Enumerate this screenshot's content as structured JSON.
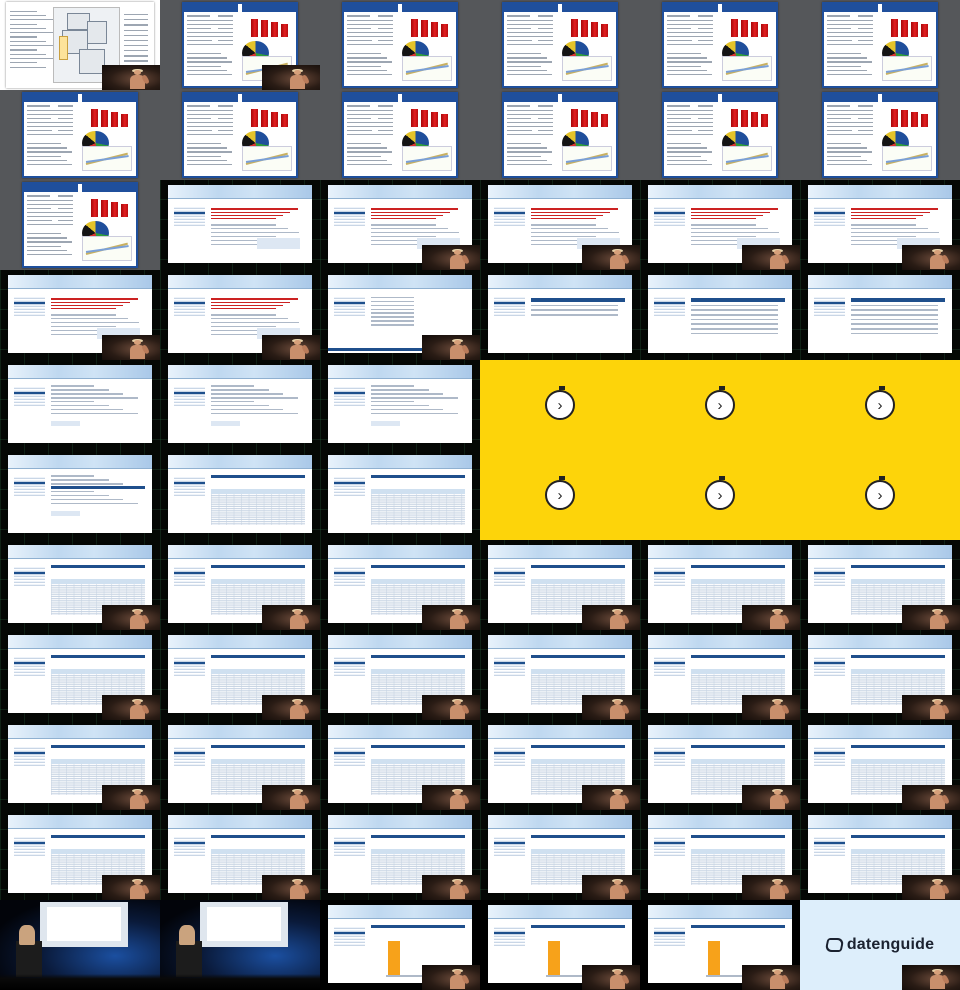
{
  "sheet": {
    "columns": 6,
    "rows": 11,
    "theme": "video thumbnail contact sheet"
  },
  "panels": [
    {
      "type": "map",
      "bg": "white"
    },
    {
      "type": "stats",
      "bg": "gray",
      "titles": [
        "Politik und Verwaltung",
        "Wirtschaft"
      ]
    },
    {
      "type": "stats",
      "bg": "gray",
      "titles": [
        "Politik und Verwaltung",
        "Wirtschaft"
      ]
    },
    {
      "type": "stats",
      "bg": "gray",
      "titles": [
        "Politik und Verwaltung",
        "Wirtschaft"
      ]
    },
    {
      "type": "stats",
      "bg": "gray",
      "titles": [
        "Politik und Verwaltung",
        "Wirtschaft"
      ]
    },
    {
      "type": "stats",
      "bg": "gray",
      "titles": [
        "Politik und Verwaltung",
        "Wirtschaft"
      ]
    },
    {
      "type": "stats",
      "bg": "gray",
      "titles": [
        "Politik und Verwaltung",
        "Wirtschaft"
      ]
    },
    {
      "type": "stats",
      "bg": "gray",
      "titles": [
        "Politik und Verwaltung",
        "Wirtschaft"
      ]
    },
    {
      "type": "stats",
      "bg": "gray",
      "titles": [
        "Politik und Verwaltung",
        "Wirtschaft"
      ]
    },
    {
      "type": "stats",
      "bg": "gray",
      "titles": [
        "Politik und Verwaltung",
        "Wirtschaft"
      ]
    },
    {
      "type": "stats",
      "bg": "gray",
      "titles": [
        "Politik und Verwaltung",
        "Wirtschaft"
      ]
    },
    {
      "type": "stats",
      "bg": "gray",
      "titles": [
        "Politik und Verwaltung",
        "Wirtschaft"
      ]
    },
    {
      "type": "stats",
      "bg": "gray",
      "titles": [
        "Politik und Verwaltung",
        "Wirtschaft"
      ]
    },
    {
      "type": "web",
      "bg": "circuit",
      "variant": "notice"
    },
    {
      "type": "web",
      "bg": "circuit",
      "variant": "notice"
    },
    {
      "type": "web",
      "bg": "circuit",
      "variant": "notice"
    },
    {
      "type": "web",
      "bg": "circuit",
      "variant": "notice"
    },
    {
      "type": "web",
      "bg": "circuit",
      "variant": "notice"
    },
    {
      "type": "web",
      "bg": "circuit",
      "variant": "notice"
    },
    {
      "type": "web",
      "bg": "circuit",
      "variant": "notice"
    },
    {
      "type": "web",
      "bg": "circuit",
      "variant": "list"
    },
    {
      "type": "web",
      "bg": "circuit",
      "variant": "search"
    },
    {
      "type": "web",
      "bg": "circuit",
      "variant": "results"
    },
    {
      "type": "web",
      "bg": "circuit",
      "variant": "results"
    },
    {
      "type": "web",
      "bg": "circuit",
      "variant": "form"
    },
    {
      "type": "web",
      "bg": "circuit",
      "variant": "form"
    },
    {
      "type": "web",
      "bg": "circuit",
      "variant": "form"
    },
    {
      "type": "stopwatch",
      "bg": "yellow"
    },
    {
      "type": "stopwatch",
      "bg": "yellow"
    },
    {
      "type": "stopwatch",
      "bg": "yellow"
    },
    {
      "type": "web",
      "bg": "circuit",
      "variant": "form2"
    },
    {
      "type": "web",
      "bg": "circuit",
      "variant": "table"
    },
    {
      "type": "web",
      "bg": "circuit",
      "variant": "table"
    },
    {
      "type": "web",
      "bg": "circuit",
      "variant": "table"
    },
    {
      "type": "web",
      "bg": "circuit",
      "variant": "table"
    },
    {
      "type": "web",
      "bg": "circuit",
      "variant": "table"
    },
    {
      "type": "web",
      "bg": "circuit",
      "variant": "table"
    },
    {
      "type": "web",
      "bg": "circuit",
      "variant": "table"
    },
    {
      "type": "web",
      "bg": "circuit",
      "variant": "table"
    },
    {
      "type": "web",
      "bg": "circuit",
      "variant": "table"
    },
    {
      "type": "web",
      "bg": "circuit",
      "variant": "table"
    },
    {
      "type": "web",
      "bg": "circuit",
      "variant": "table"
    },
    {
      "type": "web",
      "bg": "circuit",
      "variant": "table"
    },
    {
      "type": "web",
      "bg": "circuit",
      "variant": "table"
    },
    {
      "type": "web",
      "bg": "circuit",
      "variant": "table"
    },
    {
      "type": "web",
      "bg": "circuit",
      "variant": "table"
    },
    {
      "type": "web",
      "bg": "circuit",
      "variant": "table"
    },
    {
      "type": "web",
      "bg": "circuit",
      "variant": "table"
    },
    {
      "type": "web",
      "bg": "circuit",
      "variant": "table"
    },
    {
      "type": "web",
      "bg": "circuit",
      "variant": "table"
    },
    {
      "type": "web",
      "bg": "circuit",
      "variant": "table"
    },
    {
      "type": "web",
      "bg": "circuit",
      "variant": "table"
    },
    {
      "type": "web",
      "bg": "circuit",
      "variant": "table"
    },
    {
      "type": "web",
      "bg": "circuit",
      "variant": "table"
    },
    {
      "type": "web",
      "bg": "circuit",
      "variant": "table"
    },
    {
      "type": "web",
      "bg": "circuit",
      "variant": "table"
    },
    {
      "type": "web",
      "bg": "circuit",
      "variant": "table"
    },
    {
      "type": "web",
      "bg": "circuit",
      "variant": "table"
    },
    {
      "type": "web",
      "bg": "circuit",
      "variant": "table"
    },
    {
      "type": "web",
      "bg": "circuit",
      "variant": "table"
    },
    {
      "type": "web",
      "bg": "circuit",
      "variant": "table"
    },
    {
      "type": "stage",
      "bg": "stage"
    },
    {
      "type": "stage",
      "bg": "stage"
    },
    {
      "type": "web",
      "bg": "black",
      "variant": "barchart"
    },
    {
      "type": "web",
      "bg": "black",
      "variant": "barchart"
    },
    {
      "type": "web",
      "bg": "black",
      "variant": "barchart"
    },
    {
      "type": "logo",
      "bg": "lightblue",
      "text": "datenguide"
    }
  ],
  "insets": {
    "with_speaker": [
      0,
      1,
      13,
      14,
      15,
      16,
      17,
      18,
      19,
      20,
      33,
      34,
      35,
      36,
      37,
      38,
      39,
      40,
      41,
      42,
      43,
      44,
      45,
      46,
      47,
      48,
      49,
      50,
      51,
      52,
      53,
      54,
      55,
      56,
      57,
      58,
      59,
      60,
      63,
      64,
      65,
      66
    ],
    "speaker_only_cells": [
      39,
      40,
      41,
      42,
      43,
      44,
      45,
      46,
      47,
      48,
      49,
      50,
      51,
      52,
      53,
      54,
      55,
      56,
      57,
      58,
      59
    ]
  },
  "colors": {
    "stats_blue": "#1f4f9c",
    "bar_red": "#e31f21",
    "stopwatch_yellow": "#fdd40a",
    "highlight_orange": "#f7a21a",
    "nav_blue": "#1d4f8c"
  }
}
